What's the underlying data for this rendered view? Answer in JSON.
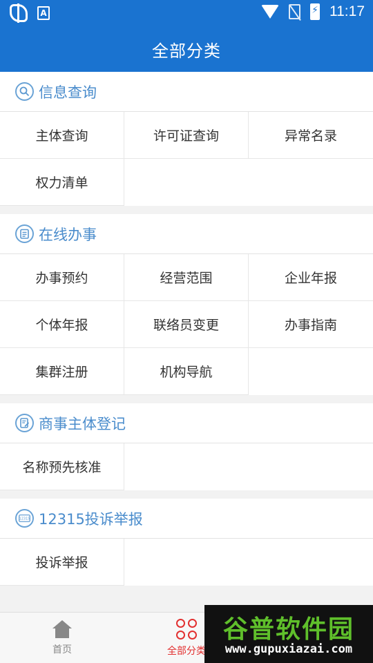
{
  "status_bar": {
    "time": "11:17",
    "a_badge": "A"
  },
  "header": {
    "title": "全部分类"
  },
  "sections": [
    {
      "title": "信息查询",
      "icon": "search-icon",
      "items": [
        "主体查询",
        "许可证查询",
        "异常名录",
        "权力清单"
      ]
    },
    {
      "title": "在线办事",
      "icon": "clipboard-icon",
      "items": [
        "办事预约",
        "经营范围",
        "企业年报",
        "个体年报",
        "联络员变更",
        "办事指南",
        "集群注册",
        "机构导航"
      ]
    },
    {
      "title": "商事主体登记",
      "icon": "edit-document-icon",
      "items": [
        "名称预先核准"
      ]
    },
    {
      "title": "12315投诉举报",
      "icon": "12315-badge-icon",
      "icon_text": "12315",
      "items": [
        "投诉举报"
      ]
    }
  ],
  "tabbar": {
    "tabs": [
      {
        "label": "首页",
        "icon": "home-icon",
        "active": false
      },
      {
        "label": "全部分类",
        "icon": "grid-icon",
        "active": true
      }
    ]
  },
  "watermark": {
    "title": "谷普软件园",
    "url": "www.gupuxiazai.com",
    "title_color": "#5fbf2b"
  },
  "colors": {
    "primary": "#1a73d0",
    "section_title": "#4a8ccc",
    "tab_active": "#e23030",
    "tab_inactive": "#888888"
  }
}
